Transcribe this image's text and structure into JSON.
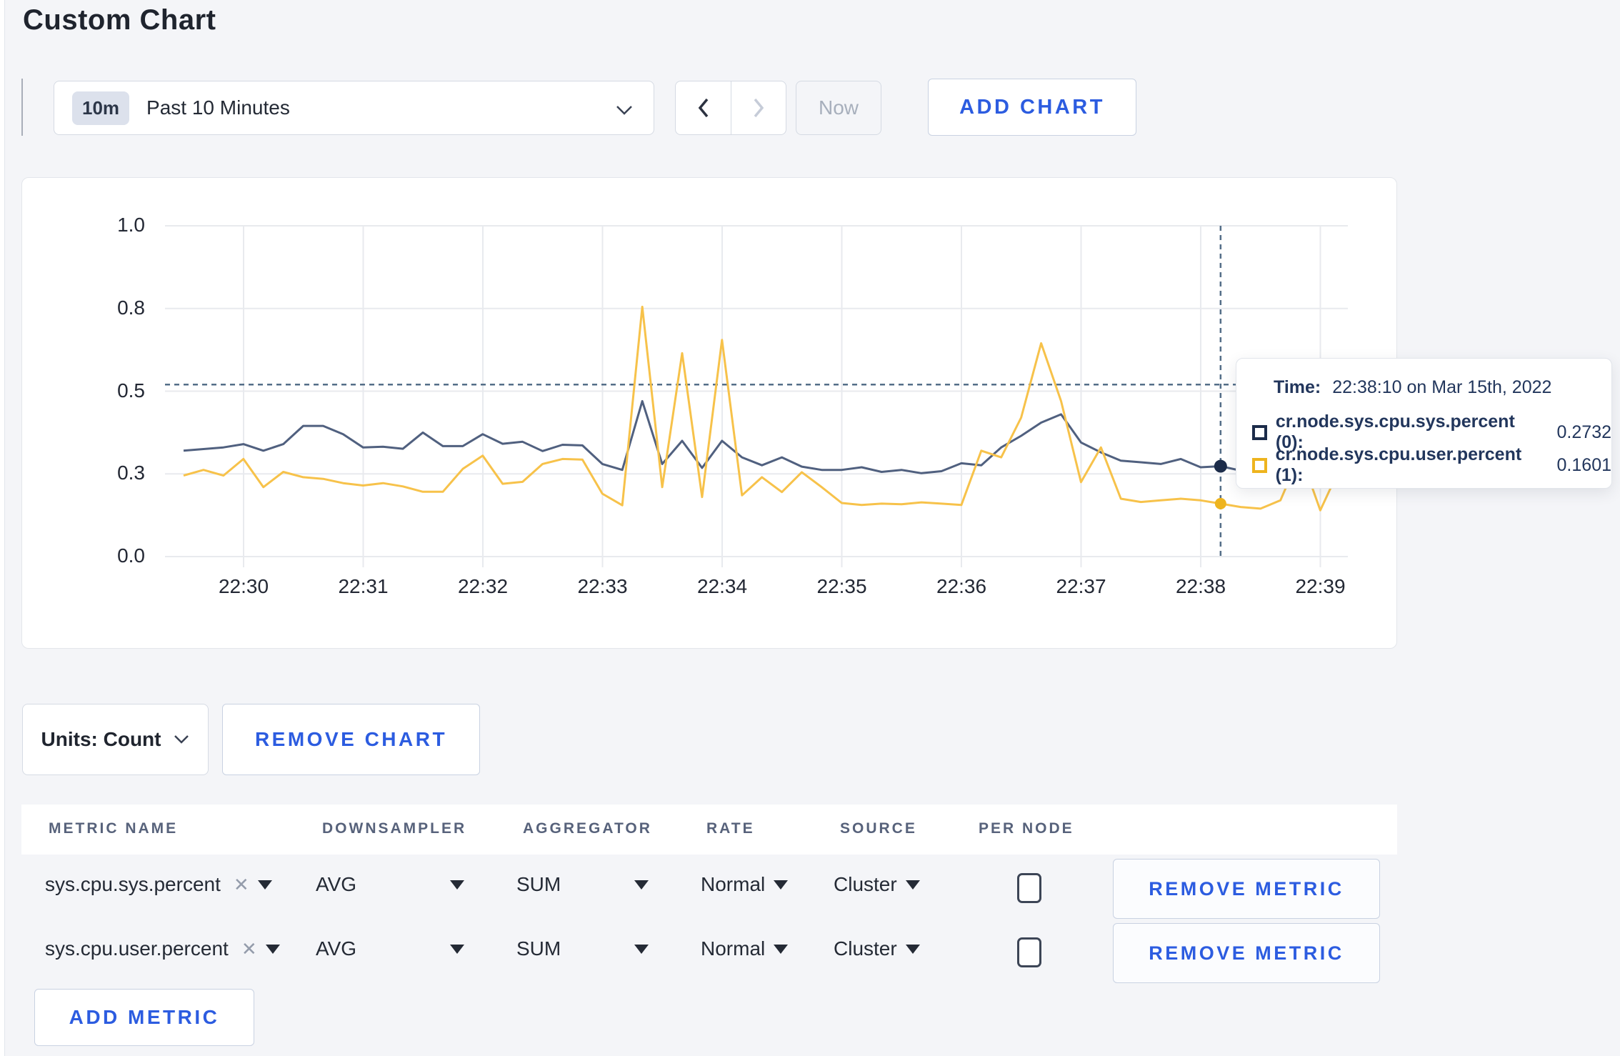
{
  "page": {
    "title": "Custom Chart",
    "background": "#f4f5f8",
    "accent_blue": "#2c5ce0"
  },
  "toolbar": {
    "time_badge": "10m",
    "time_label": "Past 10 Minutes",
    "back_icon": "chevron-left",
    "forward_icon": "chevron-right",
    "now_label": "Now",
    "add_chart_label": "ADD CHART"
  },
  "chart_data": {
    "type": "line",
    "x_start": "22:29:30",
    "x_step_seconds": 10,
    "x_ticks": [
      "22:30",
      "22:31",
      "22:32",
      "22:33",
      "22:34",
      "22:35",
      "22:36",
      "22:37",
      "22:38",
      "22:39"
    ],
    "y_tick_labels": [
      "1.0",
      "0.8",
      "0.5",
      "0.3",
      "0.0"
    ],
    "y_tick_values": [
      1.0,
      0.75,
      0.5,
      0.25,
      0.0
    ],
    "ylim": [
      0,
      1
    ],
    "grid": true,
    "series": [
      {
        "name": "cr.node.sys.cpu.sys.percent (0)",
        "color": "#50607f",
        "swatch_color": "#1c2c4a",
        "values": [
          0.32,
          0.325,
          0.33,
          0.34,
          0.32,
          0.34,
          0.395,
          0.395,
          0.37,
          0.33,
          0.332,
          0.326,
          0.375,
          0.334,
          0.334,
          0.37,
          0.341,
          0.347,
          0.319,
          0.338,
          0.336,
          0.28,
          0.262,
          0.47,
          0.28,
          0.35,
          0.268,
          0.35,
          0.3,
          0.276,
          0.3,
          0.272,
          0.262,
          0.262,
          0.27,
          0.256,
          0.262,
          0.252,
          0.258,
          0.282,
          0.276,
          0.33,
          0.365,
          0.405,
          0.43,
          0.345,
          0.315,
          0.29,
          0.285,
          0.28,
          0.295,
          0.27,
          0.2732,
          0.26,
          0.272,
          0.281,
          0.27,
          0.276,
          0.3
        ]
      },
      {
        "name": "cr.node.sys.cpu.user.percent (1)",
        "color": "#f7c24a",
        "swatch_color": "#eeb41e",
        "values": [
          0.245,
          0.262,
          0.245,
          0.295,
          0.21,
          0.256,
          0.24,
          0.235,
          0.222,
          0.215,
          0.222,
          0.212,
          0.196,
          0.196,
          0.265,
          0.305,
          0.22,
          0.226,
          0.28,
          0.295,
          0.293,
          0.19,
          0.155,
          0.755,
          0.21,
          0.615,
          0.18,
          0.655,
          0.185,
          0.24,
          0.195,
          0.255,
          0.21,
          0.162,
          0.156,
          0.16,
          0.158,
          0.164,
          0.16,
          0.156,
          0.32,
          0.3,
          0.42,
          0.645,
          0.47,
          0.225,
          0.33,
          0.175,
          0.165,
          0.17,
          0.175,
          0.17,
          0.1601,
          0.15,
          0.145,
          0.17,
          0.31,
          0.14,
          0.27
        ]
      }
    ],
    "crosshair": {
      "time": "22:38:10",
      "index": 52,
      "hline_value": 0.52,
      "color": "#546e88"
    }
  },
  "tooltip": {
    "time_label": "Time:",
    "time_value": "22:38:10 on Mar 15th, 2022",
    "rows": [
      {
        "name": "cr.node.sys.cpu.sys.percent (0):",
        "value": "0.2732",
        "swatch_color": "#1c2c4a"
      },
      {
        "name": "cr.node.sys.cpu.user.percent (1):",
        "value": "0.1601",
        "swatch_color": "#eeb41e"
      }
    ]
  },
  "chart_controls": {
    "units_label": "Units: Count",
    "remove_chart_label": "REMOVE CHART"
  },
  "metrics_table": {
    "headers": [
      "METRIC NAME",
      "DOWNSAMPLER",
      "AGGREGATOR",
      "RATE",
      "SOURCE",
      "PER NODE"
    ],
    "rows": [
      {
        "metric": "sys.cpu.sys.percent",
        "downsampler": "AVG",
        "aggregator": "SUM",
        "rate": "Normal",
        "source": "Cluster",
        "per_node_checked": false,
        "remove_label": "REMOVE METRIC"
      },
      {
        "metric": "sys.cpu.user.percent",
        "downsampler": "AVG",
        "aggregator": "SUM",
        "rate": "Normal",
        "source": "Cluster",
        "per_node_checked": false,
        "remove_label": "REMOVE METRIC"
      }
    ],
    "add_metric_label": "ADD METRIC"
  }
}
